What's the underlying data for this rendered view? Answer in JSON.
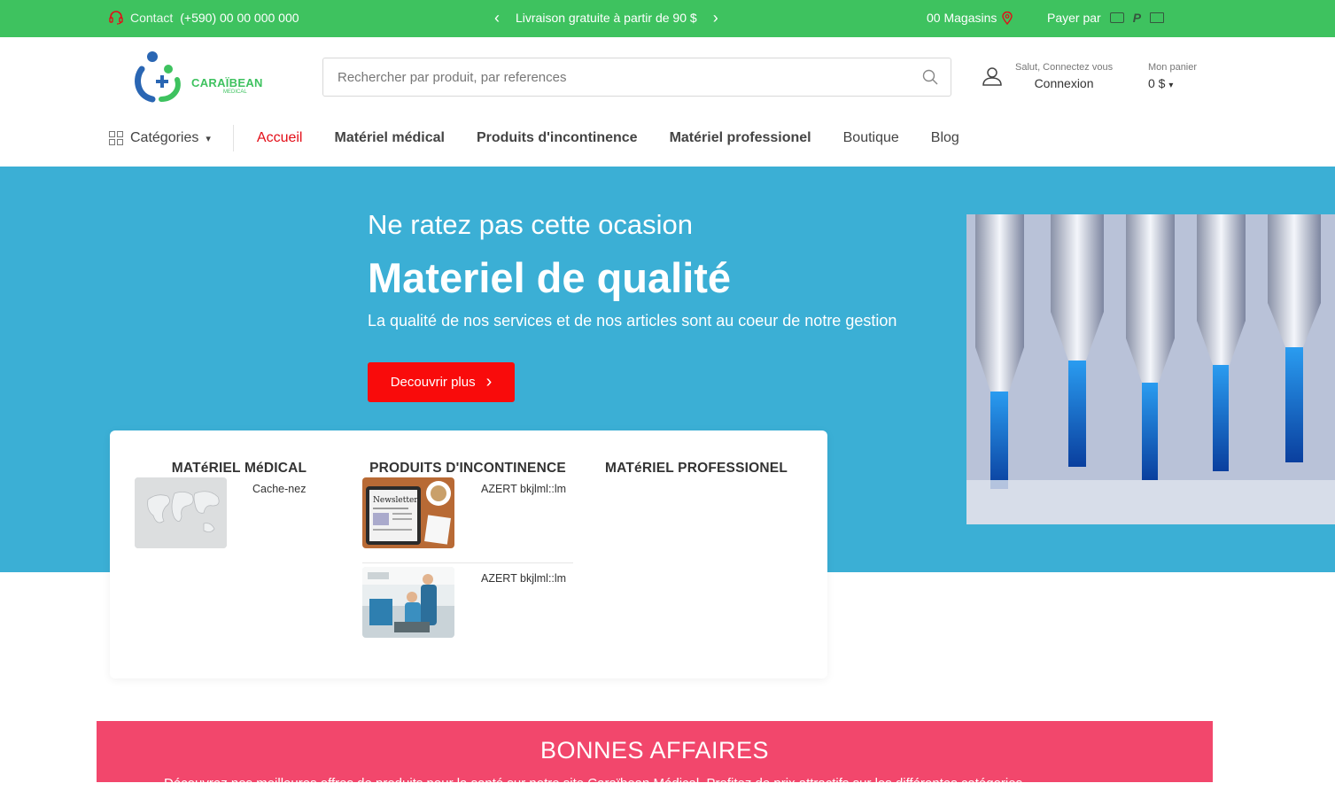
{
  "topbar": {
    "contact_label": "Contact",
    "phone": "(+590) 00 00 000 000",
    "promo_text": "Livraison gratuite à partir de 90 $",
    "stores_text": "00 Magasins",
    "pay_label": "Payer par",
    "colors": {
      "background": "#3ec25f",
      "icon_accent": "#e30d17"
    }
  },
  "header": {
    "logo_brand": "CARAÏBEAN",
    "logo_sub": "MEDICAL",
    "search_placeholder": "Rechercher par produit, par references",
    "account_greeting": "Salut, Connectez vous",
    "account_action": "Connexion",
    "cart_label": "Mon panier",
    "cart_total": "0 $"
  },
  "nav": {
    "categories_label": "Catégories",
    "items": [
      {
        "label": "Accueil",
        "active": true
      },
      {
        "label": "Matériel médical"
      },
      {
        "label": "Produits d'incontinence"
      },
      {
        "label": "Matériel professionel"
      },
      {
        "label": "Boutique"
      },
      {
        "label": "Blog"
      }
    ]
  },
  "hero": {
    "kicker": "Ne ratez pas cette ocasion",
    "title": "Materiel de qualité",
    "subtitle": "La qualité de nos services et de nos articles sont au coeur de notre gestion",
    "cta": "Decouvrir plus",
    "colors": {
      "background": "#3bafd5",
      "cta": "#f90b0b"
    }
  },
  "categories": [
    {
      "title": "MATéRIEL MéDICAL",
      "products": [
        {
          "name": "Cache-nez",
          "thumb": "world-map"
        }
      ]
    },
    {
      "title": "PRODUITS D'INCONTINENCE",
      "products": [
        {
          "name": "AZERT bkjlml::lm",
          "thumb": "newsletter"
        },
        {
          "name": "AZERT bkjlml::lm",
          "thumb": "clinic"
        }
      ]
    },
    {
      "title": "MATéRIEL PROFESSIONEL",
      "products": []
    }
  ],
  "deals": {
    "title": "BONNES AFFAIRES",
    "description": "Découvrez nos meilleures offres de produits pour la santé sur notre site Caraïbean Médical. Profitez de prix attractifs sur les différentes catégories.",
    "color": "#f2476c"
  }
}
